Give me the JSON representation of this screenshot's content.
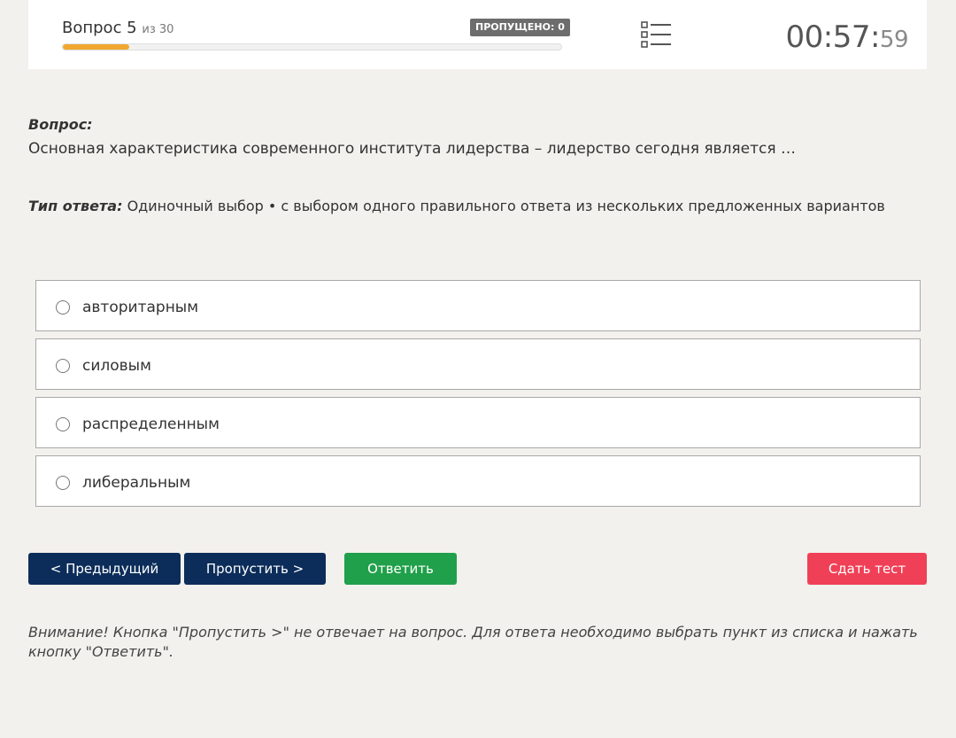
{
  "header": {
    "question_word": "Вопрос 5",
    "question_of": "из 30",
    "skipped_badge": "ПРОПУЩЕНО: 0",
    "progress_fraction": 0.133,
    "progress_color": "#f0a830",
    "list_icon": "list-icon",
    "timer_main": "00:57:",
    "timer_seconds": "59"
  },
  "question": {
    "label": "Вопрос:",
    "text": "Основная характеристика современного института лидерства – лидерство сегодня является …",
    "answer_type_label": "Тип ответа:",
    "answer_type_text": "Одиночный выбор • с выбором одного правильного ответа из нескольких предложенных вариантов"
  },
  "options": [
    {
      "label": "авторитарным"
    },
    {
      "label": "силовым"
    },
    {
      "label": "распределенным"
    },
    {
      "label": "либеральным"
    }
  ],
  "buttons": {
    "prev": "< Предыдущий",
    "skip": "Пропустить >",
    "answer": "Ответить",
    "submit": "Сдать тест"
  },
  "colors": {
    "nav_button": "#0c2d5a",
    "answer_button": "#20a04a",
    "submit_button": "#f04057"
  },
  "warning": "Внимание! Кнопка \"Пропустить >\" не отвечает на вопрос. Для ответа необходимо выбрать пункт из списка и нажать кнопку \"Ответить\"."
}
